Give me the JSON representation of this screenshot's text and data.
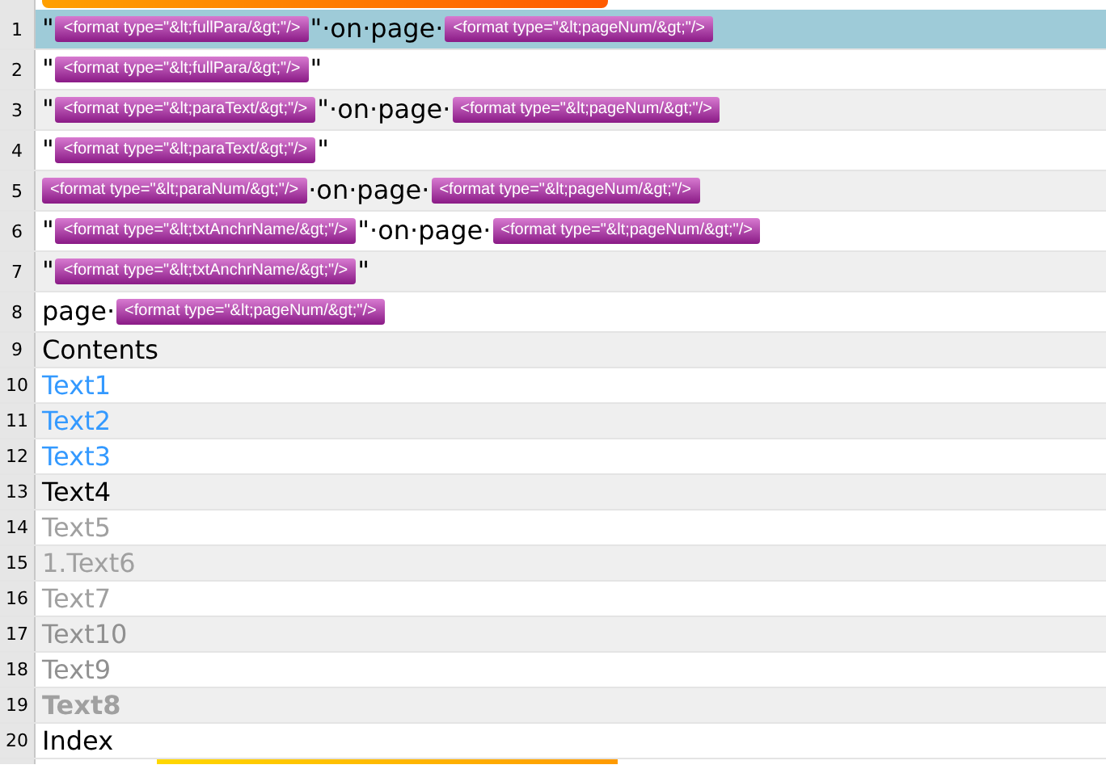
{
  "lines": [
    {
      "number": "1",
      "selected": true,
      "color": "#000000",
      "bold": false,
      "segments": [
        {
          "kind": "text",
          "text": "\""
        },
        {
          "kind": "tag",
          "text": "<format type=\"&lt;fullPara/&gt;\"/>"
        },
        {
          "kind": "text",
          "text": "\"·on·page·"
        },
        {
          "kind": "tag",
          "text": "<format type=\"&lt;pageNum/&gt;\"/>"
        }
      ]
    },
    {
      "number": "2",
      "selected": false,
      "color": "#000000",
      "bold": false,
      "segments": [
        {
          "kind": "text",
          "text": "\""
        },
        {
          "kind": "tag",
          "text": "<format type=\"&lt;fullPara/&gt;\"/>"
        },
        {
          "kind": "text",
          "text": "\""
        }
      ]
    },
    {
      "number": "3",
      "selected": false,
      "color": "#000000",
      "bold": false,
      "segments": [
        {
          "kind": "text",
          "text": "\""
        },
        {
          "kind": "tag",
          "text": "<format type=\"&lt;paraText/&gt;\"/>"
        },
        {
          "kind": "text",
          "text": "\"·on·page·"
        },
        {
          "kind": "tag",
          "text": "<format type=\"&lt;pageNum/&gt;\"/>"
        }
      ]
    },
    {
      "number": "4",
      "selected": false,
      "color": "#000000",
      "bold": false,
      "segments": [
        {
          "kind": "text",
          "text": "\""
        },
        {
          "kind": "tag",
          "text": "<format type=\"&lt;paraText/&gt;\"/>"
        },
        {
          "kind": "text",
          "text": "\""
        }
      ]
    },
    {
      "number": "5",
      "selected": false,
      "color": "#000000",
      "bold": false,
      "segments": [
        {
          "kind": "tag",
          "text": "<format type=\"&lt;paraNum/&gt;\"/>"
        },
        {
          "kind": "text",
          "text": "·on·page·"
        },
        {
          "kind": "tag",
          "text": "<format type=\"&lt;pageNum/&gt;\"/>"
        }
      ]
    },
    {
      "number": "6",
      "selected": false,
      "color": "#000000",
      "bold": false,
      "segments": [
        {
          "kind": "text",
          "text": "\""
        },
        {
          "kind": "tag",
          "text": "<format type=\"&lt;txtAnchrName/&gt;\"/>"
        },
        {
          "kind": "text",
          "text": "\"·on·page·"
        },
        {
          "kind": "tag",
          "text": "<format type=\"&lt;pageNum/&gt;\"/>"
        }
      ]
    },
    {
      "number": "7",
      "selected": false,
      "color": "#000000",
      "bold": false,
      "segments": [
        {
          "kind": "text",
          "text": "\""
        },
        {
          "kind": "tag",
          "text": "<format type=\"&lt;txtAnchrName/&gt;\"/>"
        },
        {
          "kind": "text",
          "text": "\""
        }
      ]
    },
    {
      "number": "8",
      "selected": false,
      "color": "#000000",
      "bold": false,
      "segments": [
        {
          "kind": "text",
          "text": "page·"
        },
        {
          "kind": "tag",
          "text": "<format type=\"&lt;pageNum/&gt;\"/>"
        }
      ]
    },
    {
      "number": "9",
      "selected": false,
      "color": "#000000",
      "bold": false,
      "segments": [
        {
          "kind": "text",
          "text": "Contents"
        }
      ]
    },
    {
      "number": "10",
      "selected": false,
      "color": "#3399ff",
      "bold": false,
      "segments": [
        {
          "kind": "text",
          "text": "Text1"
        }
      ]
    },
    {
      "number": "11",
      "selected": false,
      "color": "#3399ff",
      "bold": false,
      "segments": [
        {
          "kind": "text",
          "text": "Text2"
        }
      ]
    },
    {
      "number": "12",
      "selected": false,
      "color": "#3399ff",
      "bold": false,
      "segments": [
        {
          "kind": "text",
          "text": "Text3"
        }
      ]
    },
    {
      "number": "13",
      "selected": false,
      "color": "#000000",
      "bold": false,
      "segments": [
        {
          "kind": "text",
          "text": "Text4"
        }
      ]
    },
    {
      "number": "14",
      "selected": false,
      "color": "#a0a0a0",
      "bold": false,
      "segments": [
        {
          "kind": "text",
          "text": "Text5"
        }
      ]
    },
    {
      "number": "15",
      "selected": false,
      "color": "#a0a0a0",
      "bold": false,
      "segments": [
        {
          "kind": "text",
          "text": "1.Text6"
        }
      ]
    },
    {
      "number": "16",
      "selected": false,
      "color": "#a0a0a0",
      "bold": false,
      "segments": [
        {
          "kind": "text",
          "text": "Text7"
        }
      ]
    },
    {
      "number": "17",
      "selected": false,
      "color": "#909090",
      "bold": false,
      "segments": [
        {
          "kind": "text",
          "text": "Text10"
        }
      ]
    },
    {
      "number": "18",
      "selected": false,
      "color": "#909090",
      "bold": false,
      "segments": [
        {
          "kind": "text",
          "text": "Text9"
        }
      ]
    },
    {
      "number": "19",
      "selected": false,
      "color": "#a0a0a0",
      "bold": true,
      "segments": [
        {
          "kind": "text",
          "text": "Text8"
        }
      ]
    },
    {
      "number": "20",
      "selected": false,
      "color": "#000000",
      "bold": false,
      "segments": [
        {
          "kind": "text",
          "text": "Index"
        }
      ]
    }
  ]
}
